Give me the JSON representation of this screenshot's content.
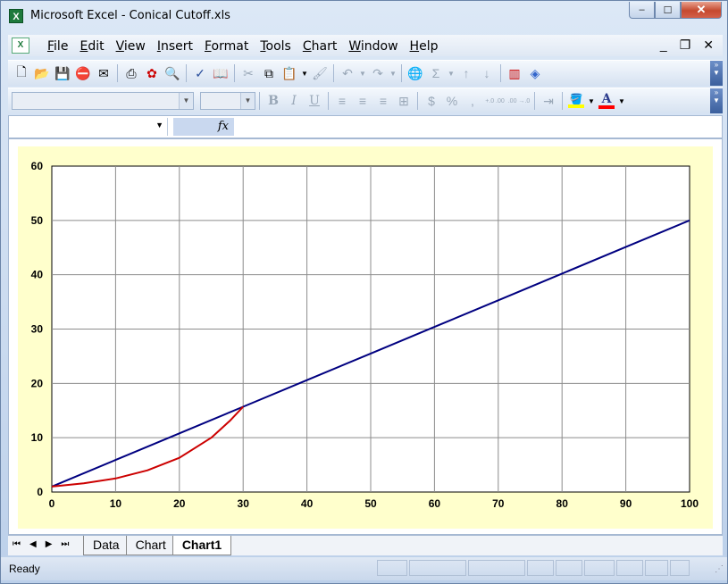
{
  "window": {
    "title": "Microsoft Excel - Conical Cutoff.xls",
    "app_icon": "excel-icon",
    "minimize": "–",
    "maximize": "☐",
    "close": "✕"
  },
  "menubar": {
    "items": [
      "File",
      "Edit",
      "View",
      "Insert",
      "Format",
      "Tools",
      "Chart",
      "Window",
      "Help"
    ],
    "doc_minimize": "_",
    "doc_restore": "❐",
    "doc_close": "✕"
  },
  "toolbar1": {
    "icons": [
      "new-icon",
      "open-icon",
      "save-icon",
      "permission-icon",
      "email-icon",
      "print-icon",
      "acrobat-icon",
      "print-preview-icon",
      "spelling-icon",
      "research-icon",
      "cut-icon",
      "copy-icon",
      "paste-icon",
      "format-painter-icon",
      "undo-icon",
      "redo-icon",
      "hyperlink-icon",
      "autosum-icon",
      "sort-ascending-icon",
      "sort-descending-icon",
      "chart-wizard-icon",
      "drawing-icon"
    ]
  },
  "toolbar2": {
    "font_name": "",
    "font_size": "",
    "bold": "B",
    "italic": "I",
    "underline": "U",
    "currency": "$",
    "percent": "%",
    "comma": ",",
    "increase_decimal": "+.0 .00",
    "decrease_decimal": ".00 →.0",
    "fill_color": "#ffff00",
    "font_color_letter": "A",
    "font_color": "#ff0000"
  },
  "formula_bar": {
    "name_box": "",
    "fx_label": "fx",
    "content": ""
  },
  "chart_data": {
    "type": "line",
    "title": "",
    "xlabel": "",
    "ylabel": "",
    "xlim": [
      0,
      100
    ],
    "ylim": [
      0,
      60
    ],
    "x_ticks": [
      0,
      10,
      20,
      30,
      40,
      50,
      60,
      70,
      80,
      90,
      100
    ],
    "y_ticks": [
      0,
      10,
      20,
      30,
      40,
      50,
      60
    ],
    "grid": true,
    "legend": "none",
    "plot_background": "#ffffff",
    "chart_background": "#ffffcc",
    "series": [
      {
        "color": "#000080",
        "x": [
          0,
          10,
          20,
          30,
          40,
          50,
          60,
          70,
          80,
          90,
          100
        ],
        "y": [
          1,
          5.9,
          10.8,
          15.7,
          20.6,
          25.5,
          30.4,
          35.3,
          40.2,
          45.1,
          50
        ]
      },
      {
        "color": "#cc0000",
        "x": [
          0,
          5,
          10,
          15,
          20,
          25,
          28,
          30
        ],
        "y": [
          1,
          1.6,
          2.5,
          4,
          6.3,
          10,
          13.2,
          15.7
        ]
      }
    ]
  },
  "sheet_tabs": {
    "nav": [
      "⏮",
      "◀",
      "▶",
      "⏭"
    ],
    "tabs": [
      "Data",
      "Chart",
      "Chart1"
    ],
    "active": "Chart1"
  },
  "status": {
    "text": "Ready"
  }
}
